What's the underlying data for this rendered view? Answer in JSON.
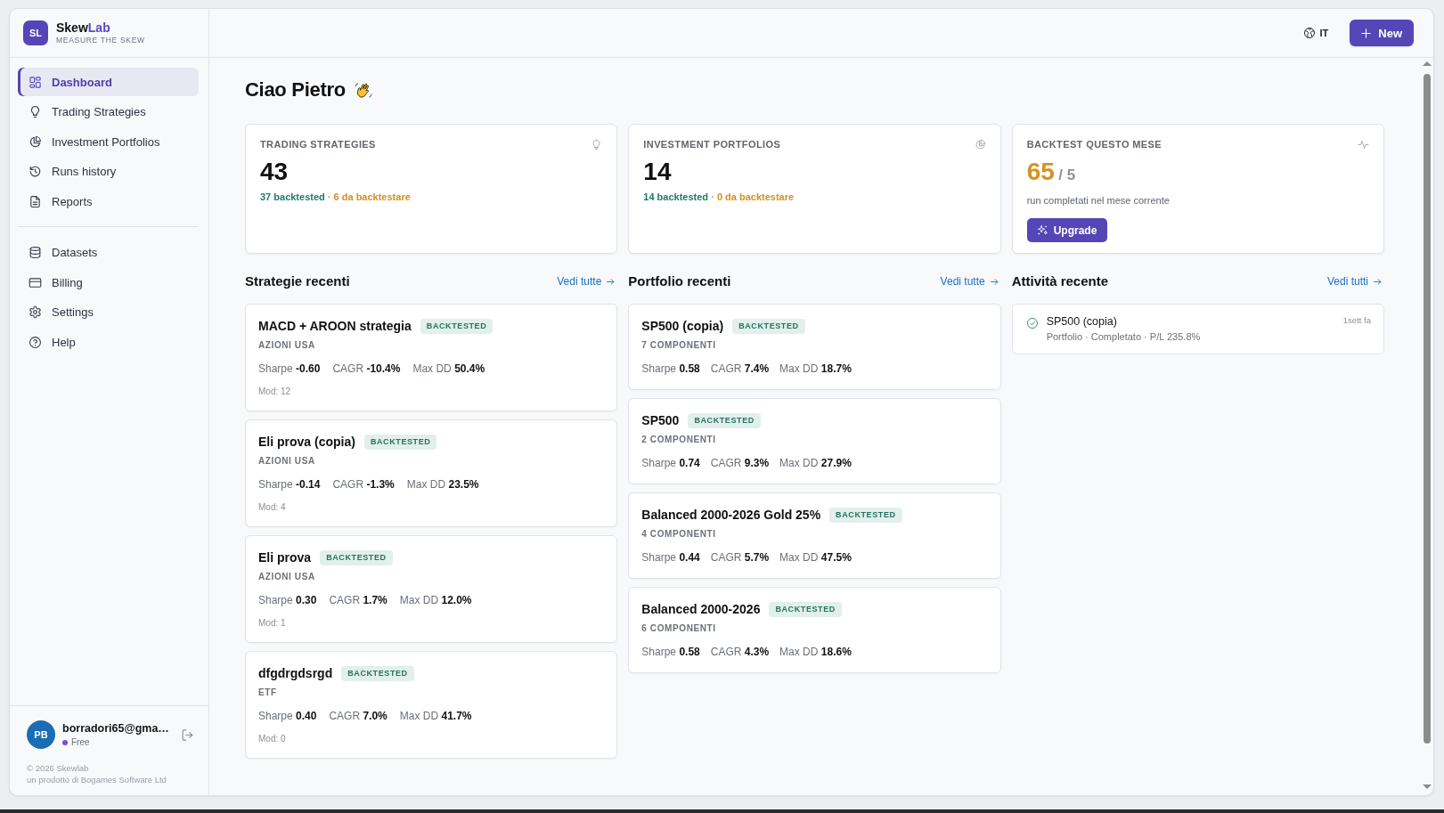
{
  "sidebar": {
    "brand": {
      "logo": "SL",
      "name": "Skew",
      "name_accent": "Lab",
      "tagline": "MEASURE THE SKEW"
    },
    "nav_sections": [
      {
        "items": [
          {
            "label": "Dashboard",
            "selected": true
          },
          {
            "label": "Trading Strategies",
            "selected": false
          },
          {
            "label": "Investment Portfolios",
            "selected": false
          },
          {
            "label": "Runs history",
            "selected": false
          },
          {
            "label": "Reports",
            "selected": false
          }
        ]
      },
      {
        "items": [
          {
            "label": "Datasets",
            "selected": false
          },
          {
            "label": "Billing",
            "selected": false
          },
          {
            "label": "Settings",
            "selected": false
          },
          {
            "label": "Help",
            "selected": false
          }
        ]
      }
    ],
    "user": {
      "initials": "PB",
      "email": "borradori65@gma…",
      "plan": "Free"
    },
    "footer": [
      "© 2026 Skewlab",
      "un prodotto di Bogames Software Ltd"
    ]
  },
  "header": {
    "language": "IT",
    "new_button": "New"
  },
  "greeting": "Ciao Pietro",
  "stats": [
    {
      "kind": "count",
      "label": "TRADING STRATEGIES",
      "value": "43",
      "backtested": "37 backtested",
      "separator": "·",
      "pending": "6 da backtestare"
    },
    {
      "kind": "count",
      "label": "INVESTMENT PORTFOLIOS",
      "value": "14",
      "backtested": "14 backtested",
      "separator": "·",
      "pending": "0 da backtestare"
    },
    {
      "kind": "quota",
      "label": "BACKTEST QUESTO MESE",
      "value": "65",
      "limit": "/ 5",
      "caption": "run completati nel mese corrente",
      "button": "Upgrade"
    }
  ],
  "sections": [
    {
      "kind": "strategies",
      "title": "Strategie recenti",
      "link": "Vedi tutte",
      "items": [
        {
          "name": "MACD + AROON strategia",
          "badge": "BACKTESTED",
          "category": "AZIONI USA",
          "metrics": [
            {
              "label": "Sharpe",
              "value": "-0.60"
            },
            {
              "label": "CAGR",
              "value": "-10.4%"
            },
            {
              "label": "Max DD",
              "value": "50.4%"
            }
          ],
          "mod": "Mod: 12"
        },
        {
          "name": "Eli prova (copia)",
          "badge": "BACKTESTED",
          "category": "AZIONI USA",
          "metrics": [
            {
              "label": "Sharpe",
              "value": "-0.14"
            },
            {
              "label": "CAGR",
              "value": "-1.3%"
            },
            {
              "label": "Max DD",
              "value": "23.5%"
            }
          ],
          "mod": "Mod: 4"
        },
        {
          "name": "Eli prova",
          "badge": "BACKTESTED",
          "category": "AZIONI USA",
          "metrics": [
            {
              "label": "Sharpe",
              "value": "0.30"
            },
            {
              "label": "CAGR",
              "value": "1.7%"
            },
            {
              "label": "Max DD",
              "value": "12.0%"
            }
          ],
          "mod": "Mod: 1"
        },
        {
          "name": "dfgdrgdsrgd",
          "badge": "BACKTESTED",
          "category": "ETF",
          "metrics": [
            {
              "label": "Sharpe",
              "value": "0.40"
            },
            {
              "label": "CAGR",
              "value": "7.0%"
            },
            {
              "label": "Max DD",
              "value": "41.7%"
            }
          ],
          "mod": "Mod: 0"
        }
      ]
    },
    {
      "kind": "portfolios",
      "title": "Portfolio recenti",
      "link": "Vedi tutte",
      "items": [
        {
          "name": "SP500 (copia)",
          "badge": "BACKTESTED",
          "category": "7 COMPONENTI",
          "metrics": [
            {
              "label": "Sharpe",
              "value": "0.58"
            },
            {
              "label": "CAGR",
              "value": "7.4%"
            },
            {
              "label": "Max DD",
              "value": "18.7%"
            }
          ]
        },
        {
          "name": "SP500",
          "badge": "BACKTESTED",
          "category": "2 COMPONENTI",
          "metrics": [
            {
              "label": "Sharpe",
              "value": "0.74"
            },
            {
              "label": "CAGR",
              "value": "9.3%"
            },
            {
              "label": "Max DD",
              "value": "27.9%"
            }
          ]
        },
        {
          "name": "Balanced 2000-2026 Gold 25%",
          "badge": "BACKTESTED",
          "category": "4 COMPONENTI",
          "metrics": [
            {
              "label": "Sharpe",
              "value": "0.44"
            },
            {
              "label": "CAGR",
              "value": "5.7%"
            },
            {
              "label": "Max DD",
              "value": "47.5%"
            }
          ]
        },
        {
          "name": "Balanced 2000-2026",
          "badge": "BACKTESTED",
          "category": "6 COMPONENTI",
          "metrics": [
            {
              "label": "Sharpe",
              "value": "0.58"
            },
            {
              "label": "CAGR",
              "value": "4.3%"
            },
            {
              "label": "Max DD",
              "value": "18.6%"
            }
          ]
        }
      ]
    },
    {
      "kind": "activity",
      "title": "Attività recente",
      "link": "Vedi tutti",
      "items": [
        {
          "completed": true,
          "title": "SP500 (copia)",
          "meta": "Portfolio · Completato · P/L 235.8%",
          "time": "1sett fa"
        }
      ]
    }
  ]
}
